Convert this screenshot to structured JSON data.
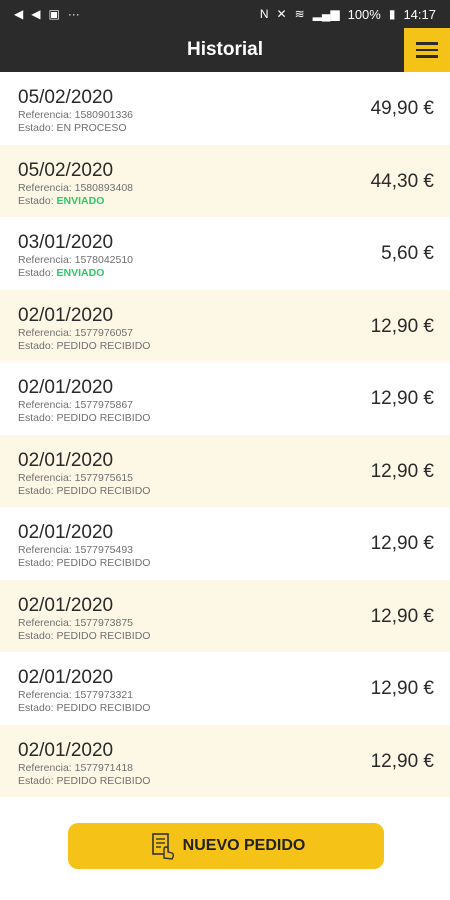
{
  "statusbar": {
    "time": "14:17",
    "battery": "100%",
    "icons_left": [
      "back-arrow-icon",
      "back-arrow-icon",
      "image-icon",
      "more-dots-icon"
    ],
    "icons_right": [
      "nfc-icon",
      "mute-icon",
      "wifi-icon",
      "signal-icon",
      "battery-icon"
    ]
  },
  "appbar": {
    "title": "Historial",
    "menu_icon": "hamburger-menu-icon"
  },
  "labels": {
    "reference": "Referencia: ",
    "state": "Estado: "
  },
  "orders": [
    {
      "date": "05/02/2020",
      "reference": "1580901336",
      "state": "EN PROCESO",
      "amount": "49,90 €"
    },
    {
      "date": "05/02/2020",
      "reference": "1580893408",
      "state": "ENVIADO",
      "amount": "44,30 €"
    },
    {
      "date": "03/01/2020",
      "reference": "1578042510",
      "state": "ENVIADO",
      "amount": "5,60 €"
    },
    {
      "date": "02/01/2020",
      "reference": "1577976057",
      "state": "PEDIDO RECIBIDO",
      "amount": "12,90 €"
    },
    {
      "date": "02/01/2020",
      "reference": "1577975867",
      "state": "PEDIDO RECIBIDO",
      "amount": "12,90 €"
    },
    {
      "date": "02/01/2020",
      "reference": "1577975615",
      "state": "PEDIDO RECIBIDO",
      "amount": "12,90 €"
    },
    {
      "date": "02/01/2020",
      "reference": "1577975493",
      "state": "PEDIDO RECIBIDO",
      "amount": "12,90 €"
    },
    {
      "date": "02/01/2020",
      "reference": "1577973875",
      "state": "PEDIDO RECIBIDO",
      "amount": "12,90 €"
    },
    {
      "date": "02/01/2020",
      "reference": "1577973321",
      "state": "PEDIDO RECIBIDO",
      "amount": "12,90 €"
    },
    {
      "date": "02/01/2020",
      "reference": "1577971418",
      "state": "PEDIDO RECIBIDO",
      "amount": "12,90 €"
    }
  ],
  "footer": {
    "new_order_label": "NUEVO PEDIDO",
    "new_order_icon": "order-form-icon"
  },
  "colors": {
    "accent": "#f5c318",
    "bar": "#2b2b2b",
    "sent": "#2ec86a",
    "row_alt": "#fdf8e6"
  }
}
